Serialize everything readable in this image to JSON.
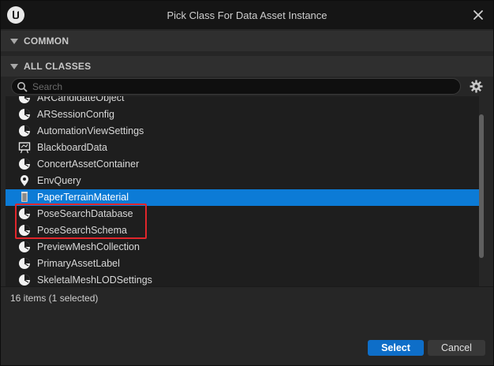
{
  "window": {
    "title": "Pick Class For Data Asset Instance"
  },
  "sections": {
    "common": "COMMON",
    "all_classes": "ALL CLASSES"
  },
  "search": {
    "placeholder": "Search",
    "value": ""
  },
  "classes": [
    {
      "label": "ARCandidateObject",
      "icon": "data-asset-icon",
      "partial": true
    },
    {
      "label": "ARSessionConfig",
      "icon": "data-asset-icon"
    },
    {
      "label": "AutomationViewSettings",
      "icon": "data-asset-icon"
    },
    {
      "label": "BlackboardData",
      "icon": "blackboard-icon"
    },
    {
      "label": "ConcertAssetContainer",
      "icon": "data-asset-icon"
    },
    {
      "label": "EnvQuery",
      "icon": "env-query-icon"
    },
    {
      "label": "PaperTerrainMaterial",
      "icon": "terrain-material-icon",
      "selected": true
    },
    {
      "label": "PoseSearchDatabase",
      "icon": "data-asset-icon"
    },
    {
      "label": "PoseSearchSchema",
      "icon": "data-asset-icon"
    },
    {
      "label": "PreviewMeshCollection",
      "icon": "data-asset-icon"
    },
    {
      "label": "PrimaryAssetLabel",
      "icon": "data-asset-icon"
    },
    {
      "label": "SkeletalMeshLODSettings",
      "icon": "data-asset-icon"
    }
  ],
  "status": {
    "text": "16 items (1 selected)"
  },
  "buttons": {
    "select": "Select",
    "cancel": "Cancel"
  },
  "colors": {
    "selection": "#0c7bd6",
    "primary_button": "#0e6ec8",
    "annotation_box": "#e0262b"
  }
}
